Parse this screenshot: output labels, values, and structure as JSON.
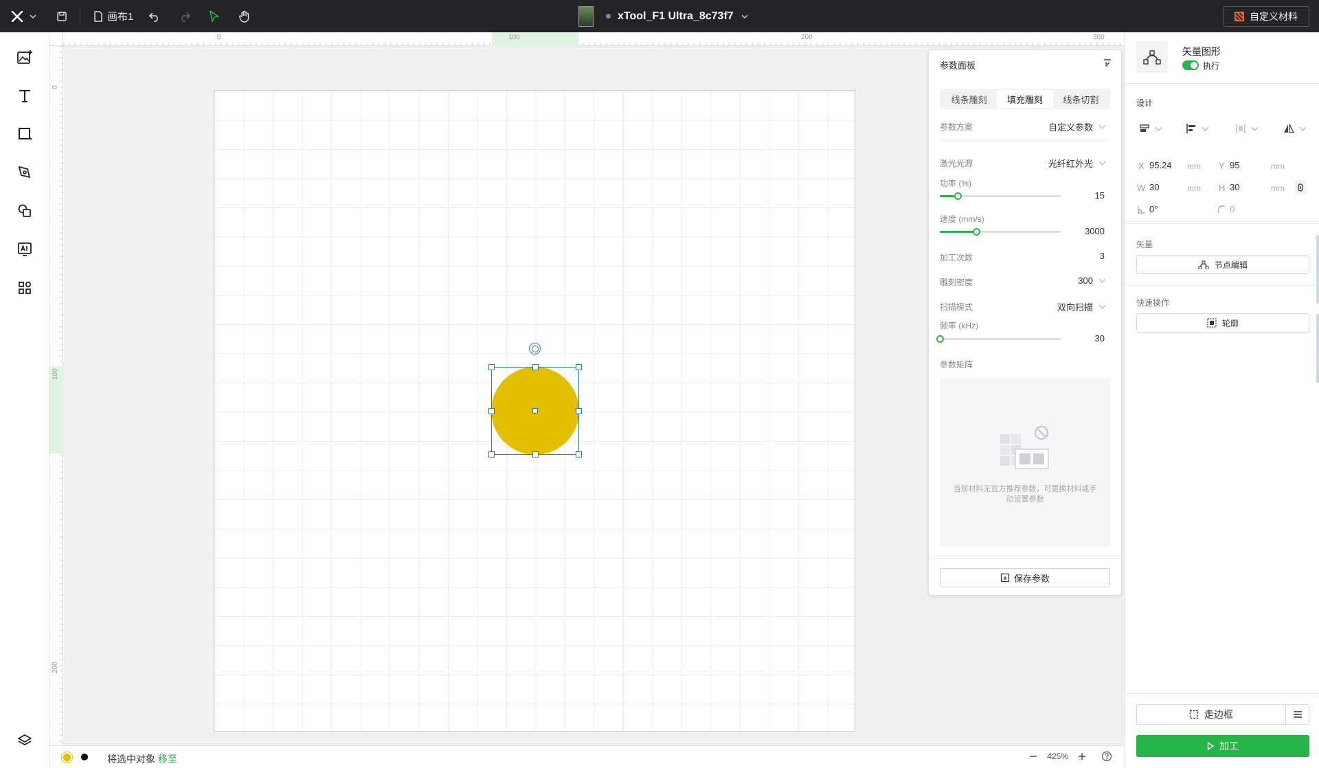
{
  "topbar": {
    "canvas_name": "画布1",
    "device_name": "xTool_F1 Ultra_8c73f7",
    "material_label": "自定义材料"
  },
  "icons": {
    "logo": "x-logo-icon",
    "save": "save-icon",
    "file": "file-icon",
    "undo": "undo-icon",
    "redo": "redo-icon",
    "select": "cursor-icon",
    "pan": "hand-icon"
  },
  "rulers": {
    "top": [
      "0",
      "100",
      "200",
      "300"
    ],
    "left": [
      "0",
      "100",
      "200"
    ]
  },
  "shape": {
    "fill": "#e2c000",
    "stroke": "#2b7e8f"
  },
  "param_panel": {
    "title": "参数面板",
    "tabs": [
      "线条雕刻",
      "填充雕刻",
      "线条切割"
    ],
    "active_tab": 1,
    "scheme_label": "参数方案",
    "scheme_value": "自定义参数",
    "laser_label": "激光光源",
    "laser_value": "光纤红外光",
    "power_label": "功率 (%)",
    "power_value": "15",
    "power_fraction": 0.15,
    "speed_label": "速度 (mm/s)",
    "speed_value": "3000",
    "speed_fraction": 0.3,
    "passes_label": "加工次数",
    "passes_value": "3",
    "density_label": "雕刻密度",
    "density_value": "300",
    "scan_label": "扫描模式",
    "scan_value": "双向扫描",
    "freq_label": "频率 (kHz)",
    "freq_value": "30",
    "freq_fraction": 0.0,
    "matrix_label": "参数矩阵",
    "matrix_empty_text": "当前材料无官方推荐参数，可更换材料或手动设置参数",
    "save_label": "保存参数"
  },
  "right_panel": {
    "object_type": "矢量图形",
    "execute_label": "执行",
    "design_label": "设计",
    "x_key": "X",
    "x_value": "95.24",
    "x_unit": "mm",
    "y_key": "Y",
    "y_value": "95",
    "y_unit": "mm",
    "w_key": "W",
    "w_value": "30",
    "w_unit": "mm",
    "h_key": "H",
    "h_value": "30",
    "h_unit": "mm",
    "rotation_value": "0°",
    "corner_value": "0",
    "vector_label": "矢量",
    "node_edit_label": "节点编辑",
    "quick_label": "快速操作",
    "outline_label": "轮廓",
    "frame_label": "走边框",
    "process_label": "加工"
  },
  "bottombar": {
    "move_text": "将选中对象",
    "move_link": "移至",
    "zoom_value": "425%",
    "dot_colors": [
      "#e2c000",
      "#111111"
    ]
  }
}
